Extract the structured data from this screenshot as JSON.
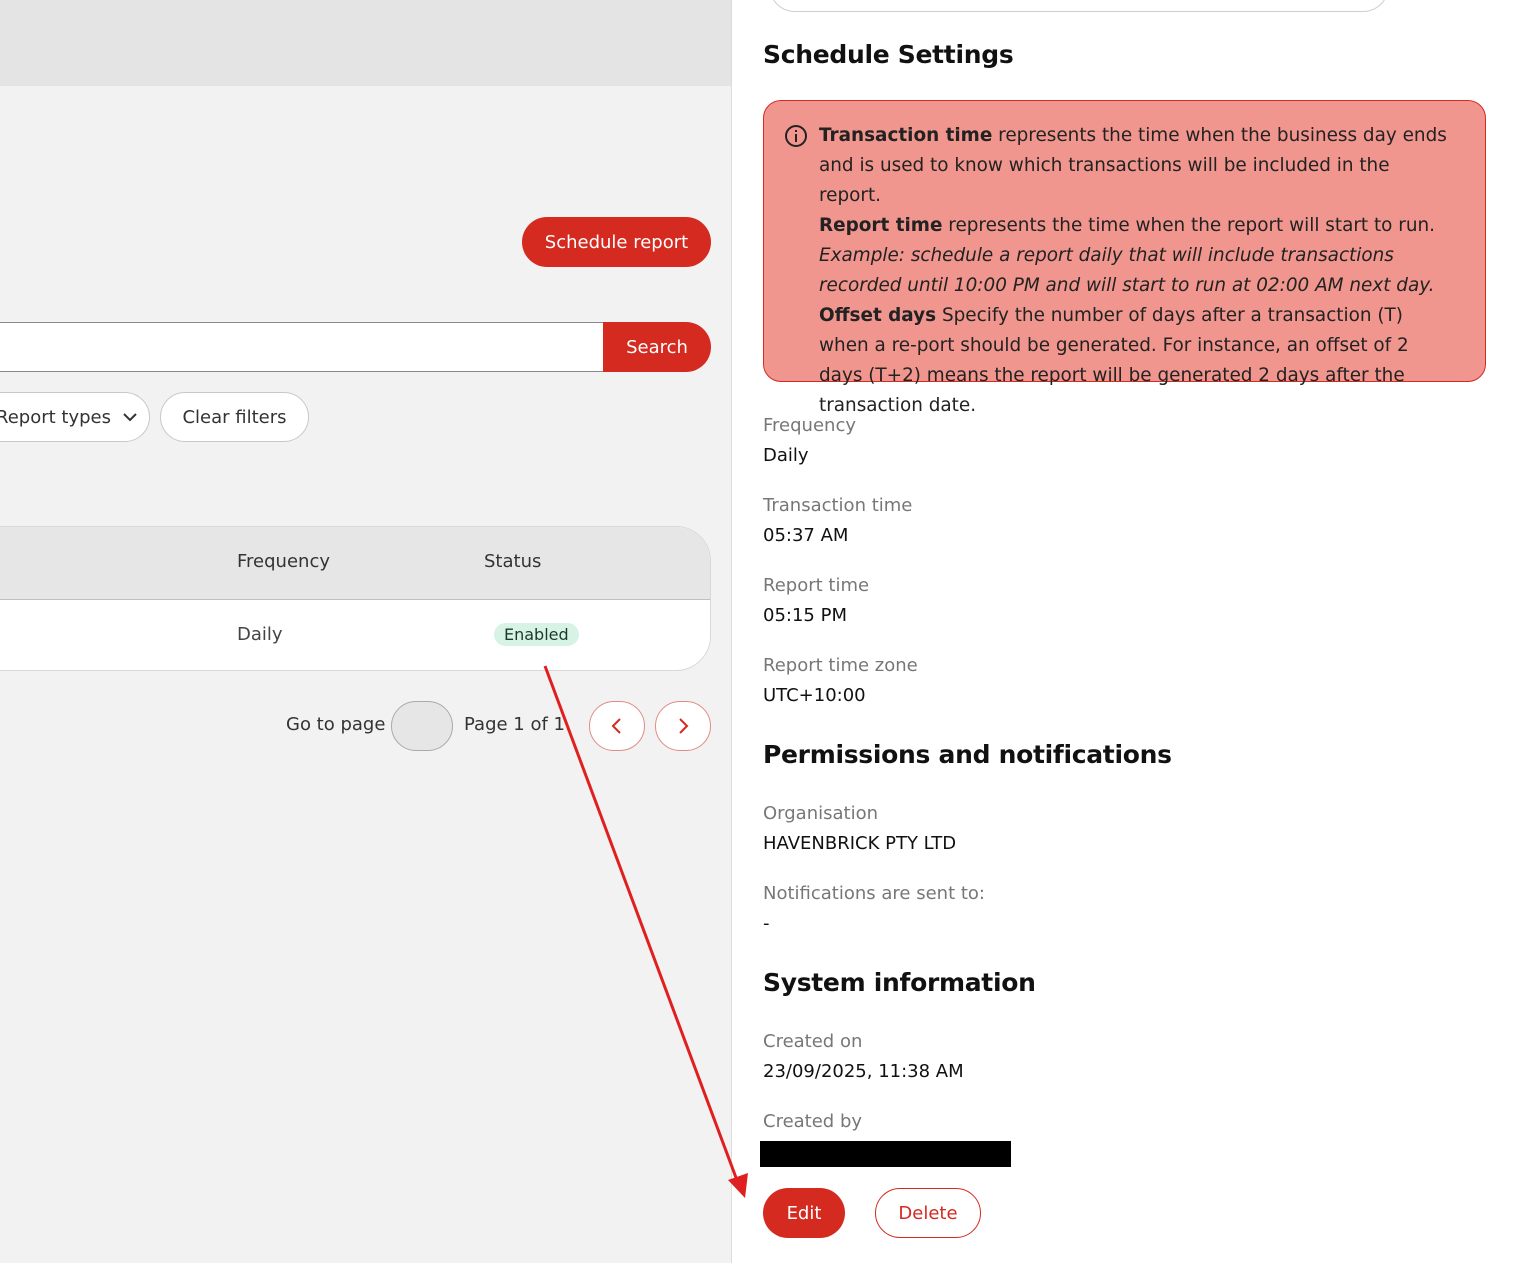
{
  "list": {
    "schedule_button": "Schedule report",
    "search": {
      "value": "",
      "button": "Search"
    },
    "filters": {
      "report_types": "Report types",
      "clear": "Clear filters"
    },
    "table": {
      "columns": {
        "frequency": "Frequency",
        "status": "Status"
      },
      "rows": [
        {
          "frequency": "Daily",
          "status": "Enabled"
        }
      ]
    },
    "pager": {
      "go_to_page": "Go to page",
      "page_info": "Page 1 of 1"
    }
  },
  "detail": {
    "schedule_settings_title": "Schedule Settings",
    "info": {
      "tx_time_term": "Transaction time",
      "tx_time_desc": " represents the time when the business day ends and is used to know which transactions will be included in the report.",
      "report_time_term": "Report time",
      "report_time_desc": " represents the time when the report will start to run.",
      "example": "Example: schedule a report daily that will include transactions recorded until 10:00 PM and will start to run at 02:00 AM next day.",
      "offset_term": "Offset days",
      "offset_desc": " Specify the number of days after a transaction (T) when a re-port should be generated. For instance, an offset of 2 days (T+2) means the report will be generated 2 days after the transaction date."
    },
    "fields": {
      "frequency_label": "Frequency",
      "frequency_value": "Daily",
      "tx_time_label": "Transaction time",
      "tx_time_value": "05:37 AM",
      "report_time_label": "Report time",
      "report_time_value": "05:15 PM",
      "tz_label": "Report time zone",
      "tz_value": "UTC+10:00"
    },
    "permissions_title": "Permissions and notifications",
    "permissions": {
      "org_label": "Organisation",
      "org_value": "HAVENBRICK PTY LTD",
      "notify_label": "Notifications are sent to:",
      "notify_value": "-"
    },
    "system_title": "System information",
    "system": {
      "created_on_label": "Created on",
      "created_on_value": "23/09/2025, 11:38 AM",
      "created_by_label": "Created by"
    },
    "actions": {
      "edit": "Edit",
      "delete": "Delete"
    }
  },
  "colors": {
    "brand_red": "#d42a20",
    "info_bg": "#f0968e",
    "badge_bg": "#d6f3e6",
    "arrow": "#e02020"
  }
}
